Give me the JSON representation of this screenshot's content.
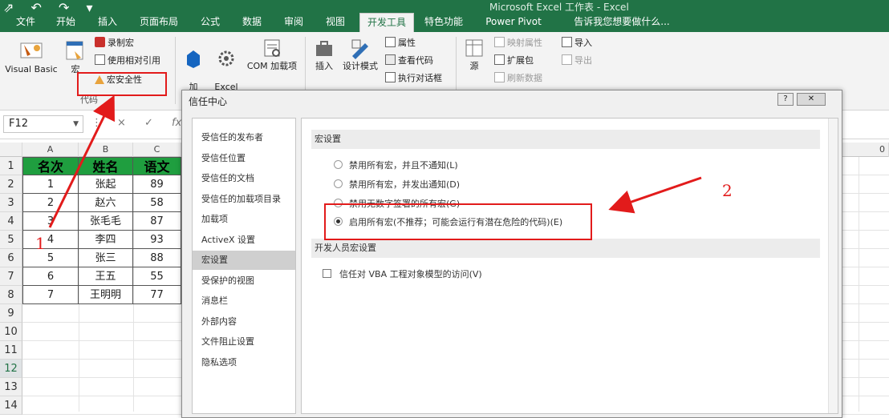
{
  "window": {
    "quick_access": "⇗ ↶ ↷ ▾",
    "title": "Microsoft Excel 工作表 - Excel"
  },
  "tabs": [
    "文件",
    "开始",
    "插入",
    "页面布局",
    "公式",
    "数据",
    "审阅",
    "视图",
    "开发工具",
    "特色功能",
    "Power Pivot",
    "告诉我您想要做什么..."
  ],
  "active_tab": "开发工具",
  "ribbon": {
    "visual_basic": "Visual Basic",
    "macros": "宏",
    "record_macro": "录制宏",
    "relative_ref": "使用相对引用",
    "macro_security": "宏安全性",
    "code_group": "代码",
    "addins": "加\n载项",
    "excel_addins": "Excel\n加载项",
    "com_addins": "COM 加载项",
    "insert": "插入",
    "design_mode": "设计模式",
    "properties": "属性",
    "view_code": "查看代码",
    "run_dialog": "执行对话框",
    "source": "源",
    "map_properties": "映射属性",
    "expansion_packs": "扩展包",
    "refresh_data": "刷新数据",
    "import": "导入",
    "export": "导出"
  },
  "formula_bar": {
    "name_box": "F12",
    "cancel": "×",
    "enter": "✓",
    "fx": "fx"
  },
  "sheet": {
    "columns": [
      "A",
      "B",
      "C"
    ],
    "extra_column": "0",
    "row_numbers": [
      "1",
      "2",
      "3",
      "4",
      "5",
      "6",
      "7",
      "8",
      "9",
      "10",
      "11",
      "12",
      "13",
      "14"
    ],
    "selected_row": "12",
    "header": [
      "名次",
      "姓名",
      "语文"
    ],
    "rows": [
      [
        "1",
        "张起",
        "89"
      ],
      [
        "2",
        "赵六",
        "58"
      ],
      [
        "3",
        "张毛毛",
        "87"
      ],
      [
        "4",
        "李四",
        "93"
      ],
      [
        "5",
        "张三",
        "88"
      ],
      [
        "6",
        "王五",
        "55"
      ],
      [
        "7",
        "王明明",
        "77"
      ]
    ]
  },
  "dialog": {
    "title": "信任中心",
    "help_btn": "?",
    "close_btn": "✕",
    "nav_items": [
      "受信任的发布者",
      "受信任位置",
      "受信任的文档",
      "受信任的加载项目录",
      "加载项",
      "ActiveX 设置",
      "宏设置",
      "受保护的视图",
      "消息栏",
      "外部内容",
      "文件阻止设置",
      "隐私选项"
    ],
    "active_nav": "宏设置",
    "macro_section": "宏设置",
    "options": [
      "禁用所有宏，并且不通知(L)",
      "禁用所有宏，并发出通知(D)",
      "禁用无数字签署的所有宏(G)",
      "启用所有宏(不推荐；可能会运行有潜在危险的代码)(E)"
    ],
    "selected_option_index": 3,
    "developer_section": "开发人员宏设置",
    "vba_checkbox": "信任对 VBA 工程对象模型的访问(V)",
    "vba_checked": false
  },
  "annotations": {
    "label_1": "1",
    "label_2": "2",
    "color": "#e21b1b"
  },
  "colors": {
    "ribbon_green": "#217346",
    "header_fill": "#1f9e3f"
  }
}
